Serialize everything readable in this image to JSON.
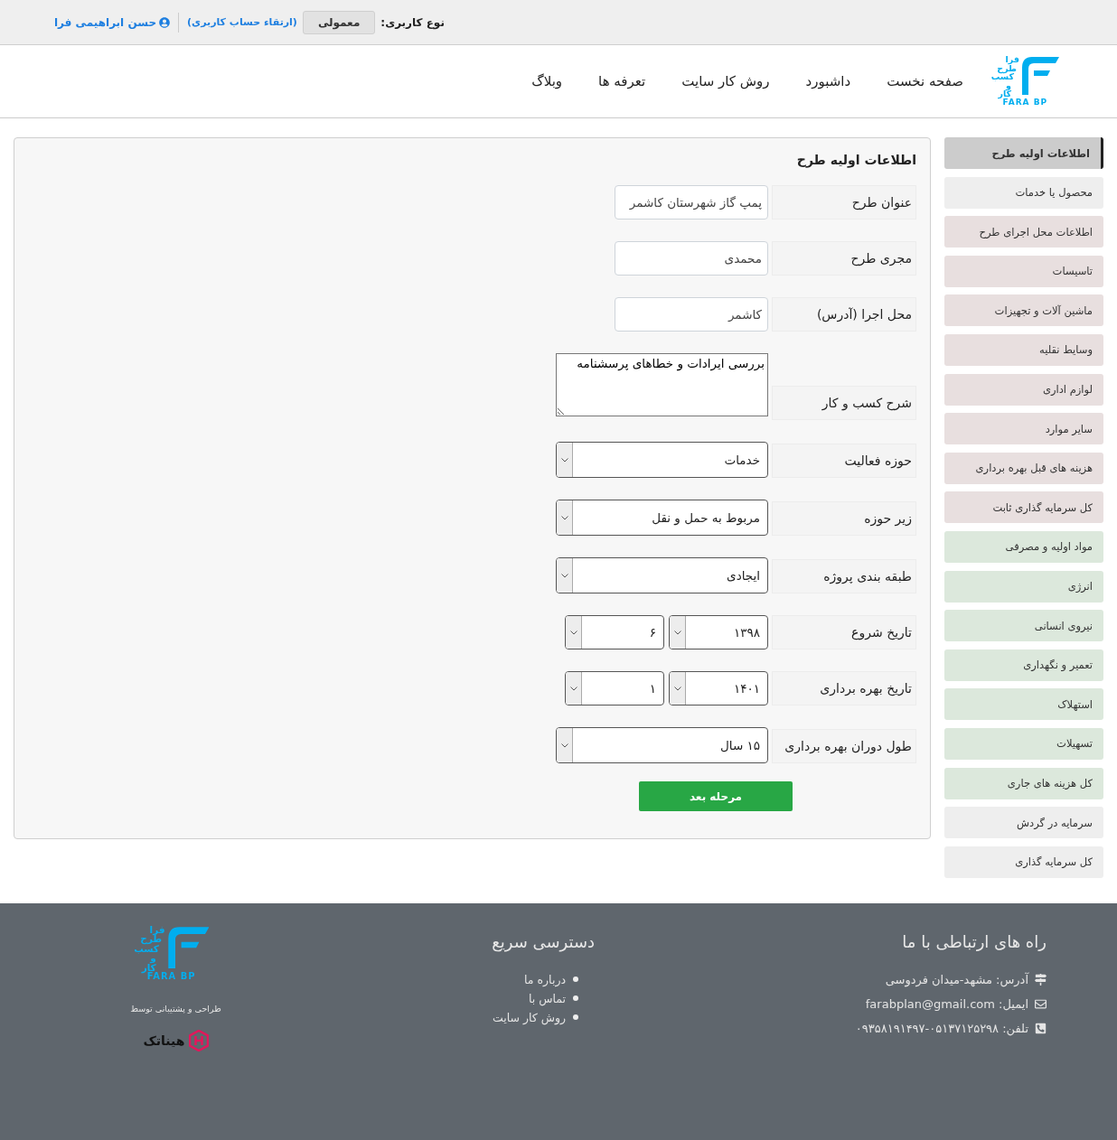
{
  "top_bar": {
    "user_type_label": "نوع کاربری:",
    "user_type": "معمولی",
    "upgrade_link": "(ارتقاء حساب کاربری)",
    "user_name": "حسن ابراهیمی فرا"
  },
  "logo": {
    "lines": [
      "فرا",
      "طرح",
      "کسب",
      "و کار"
    ],
    "latin": "FARA BP"
  },
  "nav": [
    "صفحه نخست",
    "داشبورد",
    "روش کار سایت",
    "تعرفه ها",
    "وبلاگ"
  ],
  "sidebar": {
    "items": [
      {
        "label": "اطلاعات اولیه طرح",
        "selected": true,
        "color": "#cccccc"
      },
      {
        "label": "محصول یا خدمات",
        "selected": false,
        "color": "#eeeeee"
      },
      {
        "label": "اطلاعات محل اجرای طرح",
        "selected": false,
        "color": "#e8dfdf"
      },
      {
        "label": "تاسیسات",
        "selected": false,
        "color": "#e8dfdf"
      },
      {
        "label": "ماشین آلات و تجهیزات",
        "selected": false,
        "color": "#e8dfdf"
      },
      {
        "label": "وسایط نقلیه",
        "selected": false,
        "color": "#e8dfdf"
      },
      {
        "label": "لوازم اداری",
        "selected": false,
        "color": "#e8dfdf"
      },
      {
        "label": "سایر موارد",
        "selected": false,
        "color": "#e8dfdf"
      },
      {
        "label": "هزینه های قبل بهره برداری",
        "selected": false,
        "color": "#e8dfdf"
      },
      {
        "label": "کل سرمایه گذاری ثابت",
        "selected": false,
        "color": "#e8dfdf"
      },
      {
        "label": "مواد اولیه و مصرفی",
        "selected": false,
        "color": "#dce8dc"
      },
      {
        "label": "انرژی",
        "selected": false,
        "color": "#dce8dc"
      },
      {
        "label": "نیروی انسانی",
        "selected": false,
        "color": "#dce8dc"
      },
      {
        "label": "تعمیر و نگهداری",
        "selected": false,
        "color": "#dce8dc"
      },
      {
        "label": "استهلاک",
        "selected": false,
        "color": "#dce8dc"
      },
      {
        "label": "تسهیلات",
        "selected": false,
        "color": "#dce8dc"
      },
      {
        "label": "کل هزینه های جاری",
        "selected": false,
        "color": "#dce8dc"
      },
      {
        "label": "سرمایه در گردش",
        "selected": false,
        "color": "#eeeeee"
      },
      {
        "label": "کل سرمایه گذاری",
        "selected": false,
        "color": "#eeeeee"
      }
    ]
  },
  "form": {
    "title": "اطلاعات اولیه طرح",
    "fields": [
      {
        "kind": "text",
        "label": "عنوان طرح",
        "value": "پمپ گاز شهرستان کاشمر"
      },
      {
        "kind": "text",
        "label": "مجری طرح",
        "value": "محمدی"
      },
      {
        "kind": "text",
        "label": "محل اجرا (آدرس)",
        "value": "کاشمر"
      },
      {
        "kind": "textarea",
        "label": "شرح کسب و کار",
        "value": "بررسی ایرادات و خطاهای پرسشنامه"
      },
      {
        "kind": "select",
        "label": "حوزه فعالیت",
        "value": "خدمات"
      },
      {
        "kind": "select",
        "label": "زیر حوزه",
        "value": "مربوط به حمل و نقل"
      },
      {
        "kind": "select",
        "label": "طبقه بندی پروژه",
        "value": "ایجادی"
      },
      {
        "kind": "date",
        "label": "تاریخ شروع",
        "values": [
          "۱۳۹۸",
          "۶"
        ]
      },
      {
        "kind": "date",
        "label": "تاریخ بهره برداری",
        "values": [
          "۱۴۰۱",
          "۱"
        ]
      },
      {
        "kind": "select",
        "label": "طول دوران بهره برداری",
        "value": "۱۵ سال"
      }
    ],
    "submit": "مرحله بعد"
  },
  "footer": {
    "contact": {
      "title": "راه های ارتباطی با ما",
      "items": [
        {
          "kind": "address",
          "text": "آدرس: مشهد-میدان فردوسی"
        },
        {
          "kind": "email",
          "text": "ایمیل: farabplan@gmail.com"
        },
        {
          "kind": "phone",
          "text": "تلفن: ۰۵۱۳۷۱۲۵۲۹۸-۰۹۳۵۸۱۹۱۴۹۷"
        }
      ]
    },
    "quick_links": {
      "title": "دسترسی سریع",
      "items": [
        "درباره ما",
        "تماس با",
        "روش کار سایت"
      ]
    },
    "logo": {
      "lines": [
        "فرا",
        "طرح",
        "کسب",
        "و کار"
      ],
      "latin": "FARA BP"
    },
    "credit": {
      "text": "طراحی و پشتیبانی توسط",
      "brand": "هیناتک"
    }
  }
}
